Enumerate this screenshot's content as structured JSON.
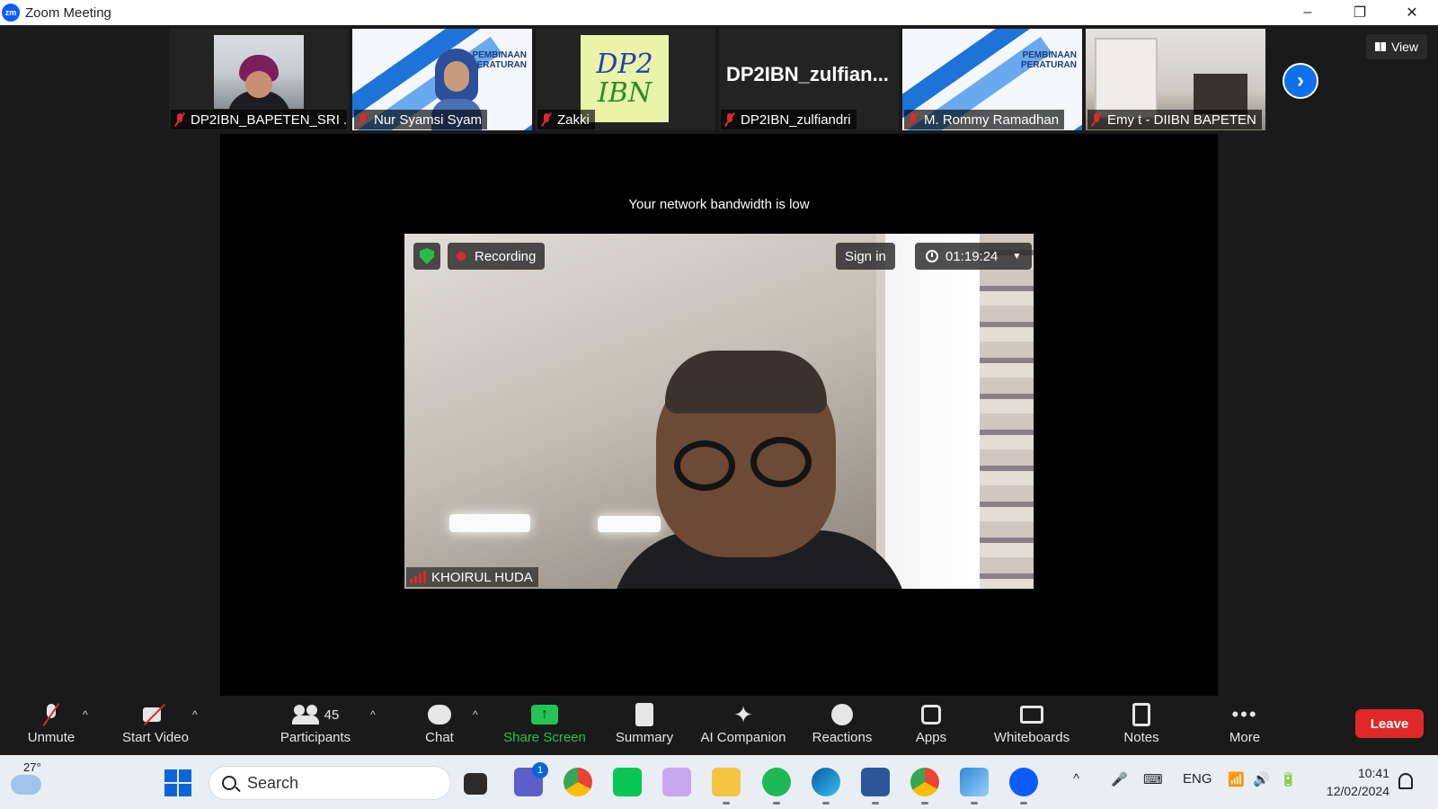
{
  "window": {
    "app_icon_text": "zm",
    "title": "Zoom Meeting",
    "controls": [
      "–",
      "❐",
      "✕"
    ]
  },
  "thumbnails": [
    {
      "name": "DP2IBN_BAPETEN_SRI ...",
      "muted": true,
      "kind": "camera"
    },
    {
      "name": "Nur Syamsi Syam",
      "muted": true,
      "kind": "banner"
    },
    {
      "name": "Zakki",
      "muted": true,
      "kind": "logo",
      "logo_lines": [
        "DP2",
        "IBN"
      ]
    },
    {
      "name": "DP2IBN_zulfiandri",
      "muted": true,
      "kind": "name",
      "tile_text": "DP2IBN_zulfian..."
    },
    {
      "name": "M. Rommy Ramadhan",
      "muted": true,
      "kind": "banner"
    },
    {
      "name": "Emy t - DIIBN BAPETEN",
      "muted": true,
      "kind": "camera"
    }
  ],
  "banner_text": [
    "PEMBINAAN",
    "PERATURAN"
  ],
  "view_button": "View",
  "stage": {
    "notice": "Your network bandwidth is low",
    "recording_label": "Recording",
    "sign_in_label": "Sign in",
    "timer": "01:19:24",
    "speaker_name": "KHOIRUL HUDA"
  },
  "toolbar": {
    "unmute": "Unmute",
    "start_video": "Start Video",
    "participants": "Participants",
    "participants_count": "45",
    "chat": "Chat",
    "share_screen": "Share Screen",
    "summary": "Summary",
    "ai_companion": "AI Companion",
    "reactions": "Reactions",
    "apps": "Apps",
    "whiteboards": "Whiteboards",
    "notes": "Notes",
    "more": "More",
    "leave": "Leave"
  },
  "taskbar": {
    "temperature": "27°",
    "search_placeholder": "Search",
    "teams_badge": "1",
    "language": "ENG",
    "time": "10:41",
    "date": "12/02/2024"
  },
  "colors": {
    "accent_blue": "#0e71eb",
    "share_green": "#23c454",
    "leave_red": "#e02828",
    "recording_red": "#e02828",
    "shield_green": "#2bbb4a"
  }
}
